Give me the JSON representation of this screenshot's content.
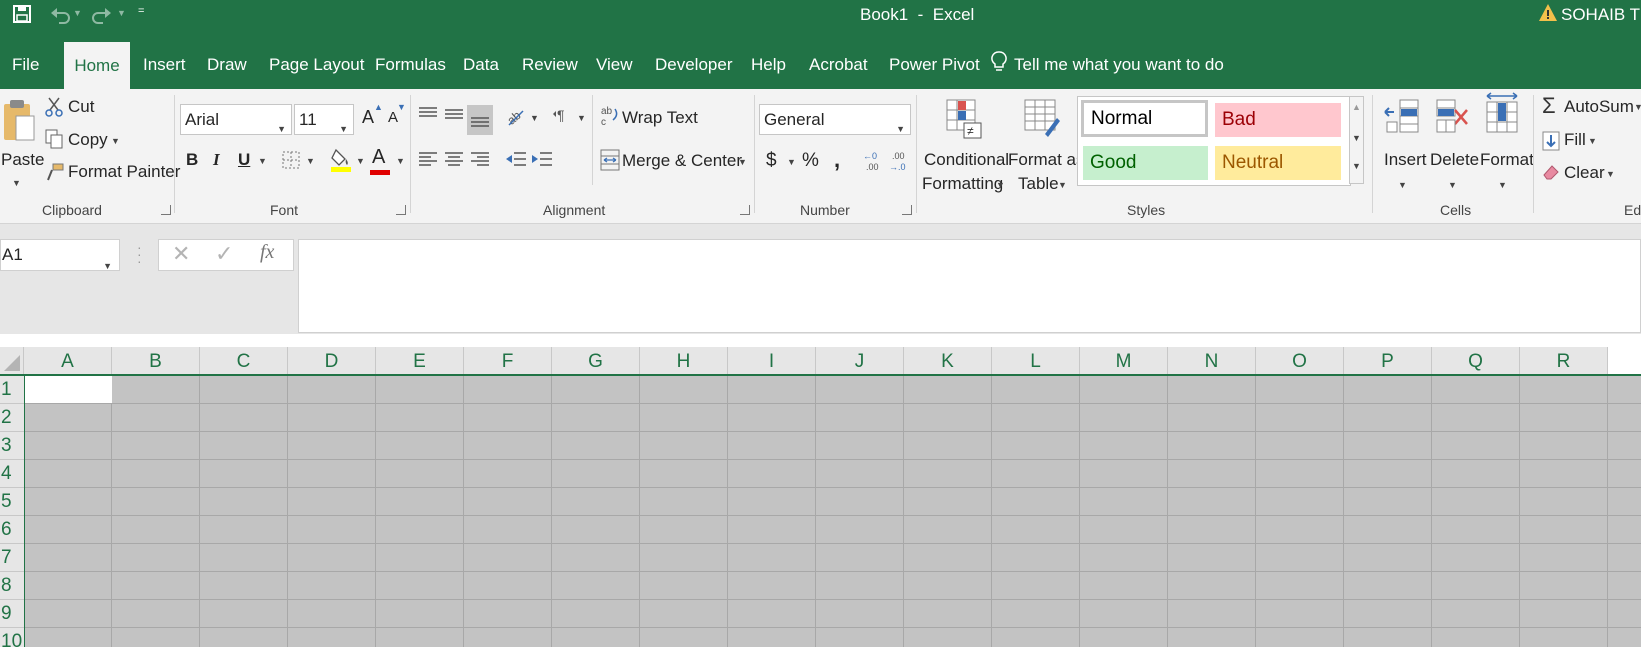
{
  "window": {
    "title": "Book1  -  Excel",
    "user": "SOHAIB TRA"
  },
  "tabs": [
    {
      "label": "File"
    },
    {
      "label": "Home"
    },
    {
      "label": "Insert"
    },
    {
      "label": "Draw"
    },
    {
      "label": "Page Layout"
    },
    {
      "label": "Formulas"
    },
    {
      "label": "Data"
    },
    {
      "label": "Review"
    },
    {
      "label": "View"
    },
    {
      "label": "Developer"
    },
    {
      "label": "Help"
    },
    {
      "label": "Acrobat"
    },
    {
      "label": "Power Pivot"
    }
  ],
  "tell_me": "Tell me what you want to do",
  "clipboard": {
    "paste": "Paste",
    "cut": "Cut",
    "copy": "Copy",
    "format_painter": "Format Painter",
    "group": "Clipboard"
  },
  "font": {
    "name": "Arial",
    "size": "11",
    "bold": "B",
    "italic": "I",
    "underline": "U",
    "group": "Font",
    "grow": "A",
    "shrink": "A",
    "color_letter": "A",
    "highlight_color": "#ffff00",
    "font_color": "#e00000"
  },
  "alignment": {
    "wrap_text": "Wrap Text",
    "merge_center": "Merge & Center",
    "group": "Alignment"
  },
  "number": {
    "format": "General",
    "currency": "$",
    "percent": "%",
    "comma": ",",
    "group": "Number"
  },
  "styles": {
    "conditional_formatting": [
      "Conditional",
      "Formatting"
    ],
    "format_as_table": [
      "Format as",
      "Table"
    ],
    "normal": "Normal",
    "bad": "Bad",
    "good": "Good",
    "neutral": "Neutral",
    "group": "Styles",
    "colors": {
      "bad_bg": "#ffc7ce",
      "bad_fg": "#9c0006",
      "good_bg": "#c6efce",
      "good_fg": "#006100",
      "neutral_bg": "#ffeb9c",
      "neutral_fg": "#9c5700"
    }
  },
  "cells": {
    "insert": "Insert",
    "delete": "Delete",
    "format": "Format",
    "group": "Cells"
  },
  "editing": {
    "autosum": "AutoSum",
    "fill": "Fill",
    "clear": "Clear",
    "group": "Edi"
  },
  "formula_bar": {
    "name_box": "A1",
    "fx": "fx",
    "formula": ""
  },
  "sheet": {
    "columns": [
      "A",
      "B",
      "C",
      "D",
      "E",
      "F",
      "G",
      "H",
      "I",
      "J",
      "K",
      "L",
      "M",
      "N",
      "O",
      "P",
      "Q",
      "R"
    ],
    "rows": [
      "1",
      "2",
      "3",
      "4",
      "5",
      "6",
      "7",
      "8",
      "9",
      "10"
    ],
    "active_cell": "A1"
  },
  "colors": {
    "accent": "#217346",
    "grid_fill": "#c3c3c3"
  }
}
